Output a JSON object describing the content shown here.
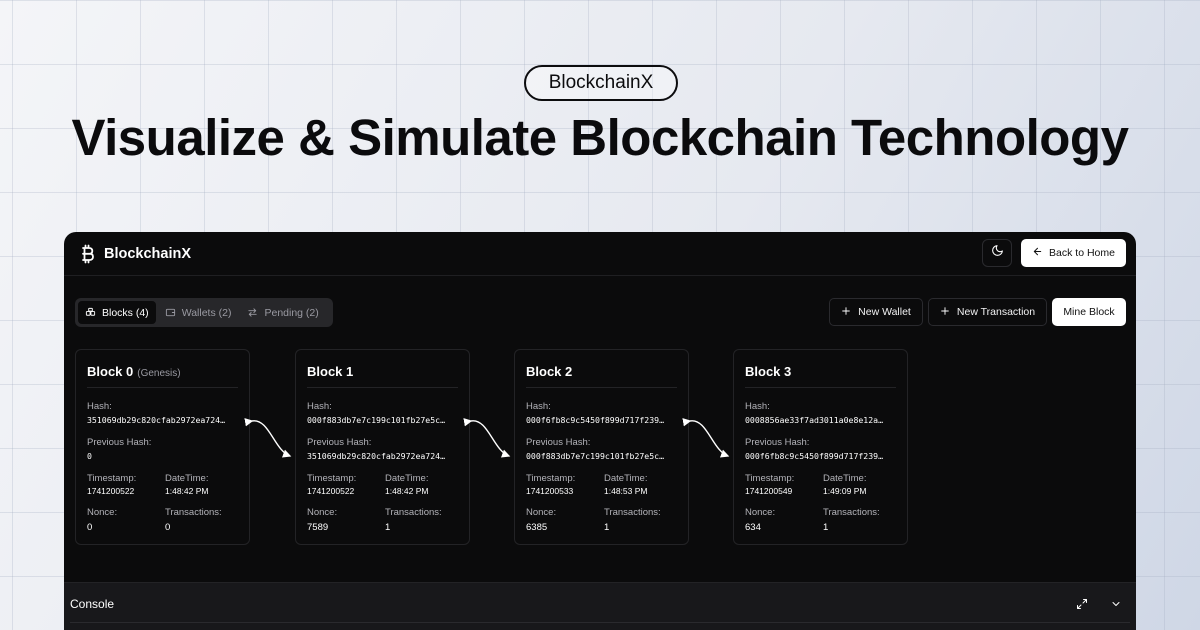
{
  "hero": {
    "badge": "BlockchainX",
    "title": "Visualize & Simulate Blockchain Technology"
  },
  "app": {
    "brand": "BlockchainX",
    "brand_icon": "bitcoin-icon",
    "theme_icon": "moon-icon",
    "back_label": "Back to Home",
    "tabs": [
      {
        "label": "Blocks (4)",
        "icon": "blocks-icon",
        "active": true
      },
      {
        "label": "Wallets (2)",
        "icon": "wallet-icon",
        "active": false
      },
      {
        "label": "Pending (2)",
        "icon": "swap-arrows-icon",
        "active": false
      }
    ],
    "actions": {
      "new_wallet": "New Wallet",
      "new_transaction": "New Transaction",
      "mine_block": "Mine Block"
    },
    "labels": {
      "hash": "Hash:",
      "previous_hash": "Previous Hash:",
      "timestamp": "Timestamp:",
      "datetime": "DateTime:",
      "nonce": "Nonce:",
      "transactions": "Transactions:"
    },
    "blocks": [
      {
        "title": "Block 0",
        "subtitle": "(Genesis)",
        "hash": "351069db29c820cfab2972ea724…",
        "previous_hash": "0",
        "timestamp": "1741200522",
        "datetime": "1:48:42 PM",
        "nonce": "0",
        "transactions": "0"
      },
      {
        "title": "Block 1",
        "subtitle": "",
        "hash": "000f883db7e7c199c101fb27e5c…",
        "previous_hash": "351069db29c820cfab2972ea724…",
        "timestamp": "1741200522",
        "datetime": "1:48:42 PM",
        "nonce": "7589",
        "transactions": "1"
      },
      {
        "title": "Block 2",
        "subtitle": "",
        "hash": "000f6fb8c9c5450f899d717f239…",
        "previous_hash": "000f883db7e7c199c101fb27e5c…",
        "timestamp": "1741200533",
        "datetime": "1:48:53 PM",
        "nonce": "6385",
        "transactions": "1"
      },
      {
        "title": "Block 3",
        "subtitle": "",
        "hash": "0008856ae33f7ad3011a0e8e12a…",
        "previous_hash": "000f6fb8c9c5450f899d717f239…",
        "timestamp": "1741200549",
        "datetime": "1:49:09 PM",
        "nonce": "634",
        "transactions": "1"
      }
    ],
    "console": {
      "title": "Console",
      "expand_icon": "expand-icon",
      "collapse_icon": "chevron-down-icon"
    }
  }
}
